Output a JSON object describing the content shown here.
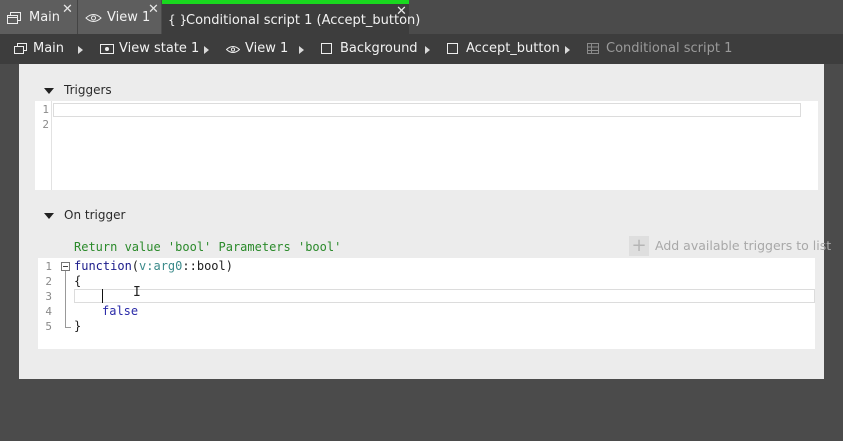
{
  "tabs": [
    {
      "label": "Main",
      "icon": "window-icon",
      "close": "✕"
    },
    {
      "label": "View 1",
      "icon": "eye-icon",
      "close": "✕"
    },
    {
      "label": "Conditional script 1 (Accept_button)",
      "icon": "braces-icon",
      "icon_text": "{ }",
      "close": "✕",
      "active": true
    }
  ],
  "breadcrumb": [
    {
      "label": "Main",
      "icon": "window-icon"
    },
    {
      "label": "View state 1",
      "icon": "view-state-icon"
    },
    {
      "label": "View 1",
      "icon": "eye-icon"
    },
    {
      "label": "Background",
      "icon": "checkbox-icon"
    },
    {
      "label": "Accept_button",
      "icon": "checkbox-icon"
    },
    {
      "label": "Conditional script 1",
      "icon": "script-grid-icon"
    }
  ],
  "triggers": {
    "title": "Triggers",
    "line_numbers": [
      "1",
      "2"
    ]
  },
  "on_trigger": {
    "title": "On trigger",
    "signature": "Return value 'bool' Parameters 'bool'",
    "add_label": "Add available triggers to list",
    "add_icon": "+",
    "line_numbers": [
      "1",
      "2",
      "3",
      "4",
      "5"
    ],
    "code": {
      "kw_function": "function",
      "open_paren": "(",
      "param": "v:arg0",
      "type": "::bool)",
      "open_brace": "{",
      "return_value": "false",
      "close_brace": "}"
    }
  },
  "colors": {
    "active_tab_accent": "#19d81f",
    "signature_text": "#2a8a2a",
    "keyword": "#1b1b8a"
  }
}
